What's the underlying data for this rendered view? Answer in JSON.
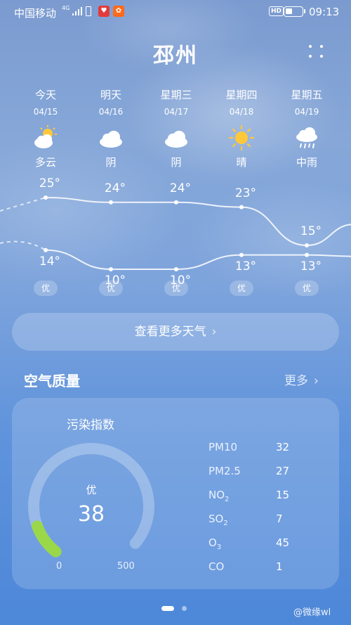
{
  "status_bar": {
    "carrier": "中国移动",
    "network": "4G",
    "hd": "HD",
    "time": "09:13",
    "battery_level": 0.45
  },
  "header": {
    "city": "邳州"
  },
  "forecast": [
    {
      "day": "今天",
      "date": "04/15",
      "icon": "partly-cloudy-icon",
      "condition": "多云",
      "high": "25°",
      "low": "14°",
      "aqi": "优"
    },
    {
      "day": "明天",
      "date": "04/16",
      "icon": "cloud-icon",
      "condition": "阴",
      "high": "24°",
      "low": "10°",
      "aqi": "优"
    },
    {
      "day": "星期三",
      "date": "04/17",
      "icon": "cloud-icon",
      "condition": "阴",
      "high": "24°",
      "low": "10°",
      "aqi": "优"
    },
    {
      "day": "星期四",
      "date": "04/18",
      "icon": "sun-icon",
      "condition": "晴",
      "high": "23°",
      "low": "13°",
      "aqi": "优"
    },
    {
      "day": "星期五",
      "date": "04/19",
      "icon": "rain-cloud-icon",
      "condition": "中雨",
      "high": "15°",
      "low": "13°",
      "aqi": "优"
    }
  ],
  "more_weather_label": "查看更多天气",
  "air_quality": {
    "title": "空气质量",
    "more": "更多",
    "index_label": "污染指数",
    "status": "优",
    "value": "38",
    "gauge_min": "0",
    "gauge_max": "500",
    "gauge_fraction": 0.076,
    "pollutants": [
      {
        "name": "PM10",
        "value": "32"
      },
      {
        "name": "PM2.5",
        "value": "27"
      },
      {
        "name": "NO2",
        "value": "15"
      },
      {
        "name": "SO2",
        "value": "7"
      },
      {
        "name": "O3",
        "value": "45"
      },
      {
        "name": "CO",
        "value": "1"
      }
    ]
  },
  "watermark": "@微缘wl",
  "colors": {
    "gauge_good": "#9ad84a",
    "sun": "#ffc83a"
  }
}
